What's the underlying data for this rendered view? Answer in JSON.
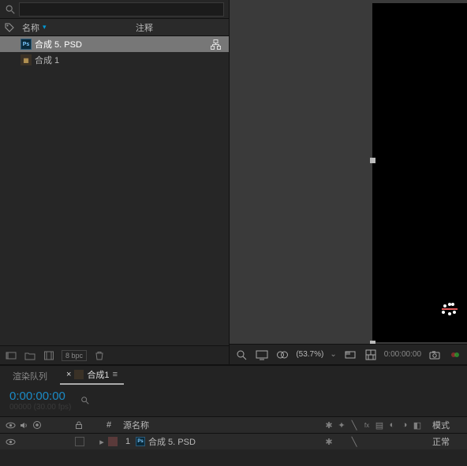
{
  "search": {
    "placeholder": ""
  },
  "columns": {
    "name": "名称",
    "comment": "注释"
  },
  "project_items": [
    {
      "icon": "psd",
      "label": "合成 5. PSD",
      "selected": true,
      "flow": true
    },
    {
      "icon": "comp",
      "label": "合成 1",
      "selected": false,
      "flow": false
    }
  ],
  "project_footer": {
    "bpc": "8 bpc"
  },
  "viewer": {
    "zoom": "(53.7%)",
    "timecode": "0:00:00:00"
  },
  "timeline": {
    "tabs": [
      {
        "label": "渲染队列",
        "active": false
      },
      {
        "label": "合成1",
        "active": true
      }
    ],
    "timecode": "0:00:00:00",
    "fps": "00000 (30.00 fps)",
    "search_placeholder": "",
    "header": {
      "num": "#",
      "source": "源名称",
      "mode": "模式"
    },
    "layers": [
      {
        "index": 1,
        "icon": "psd",
        "label": "合成 5. PSD",
        "mode": "正常"
      }
    ]
  }
}
